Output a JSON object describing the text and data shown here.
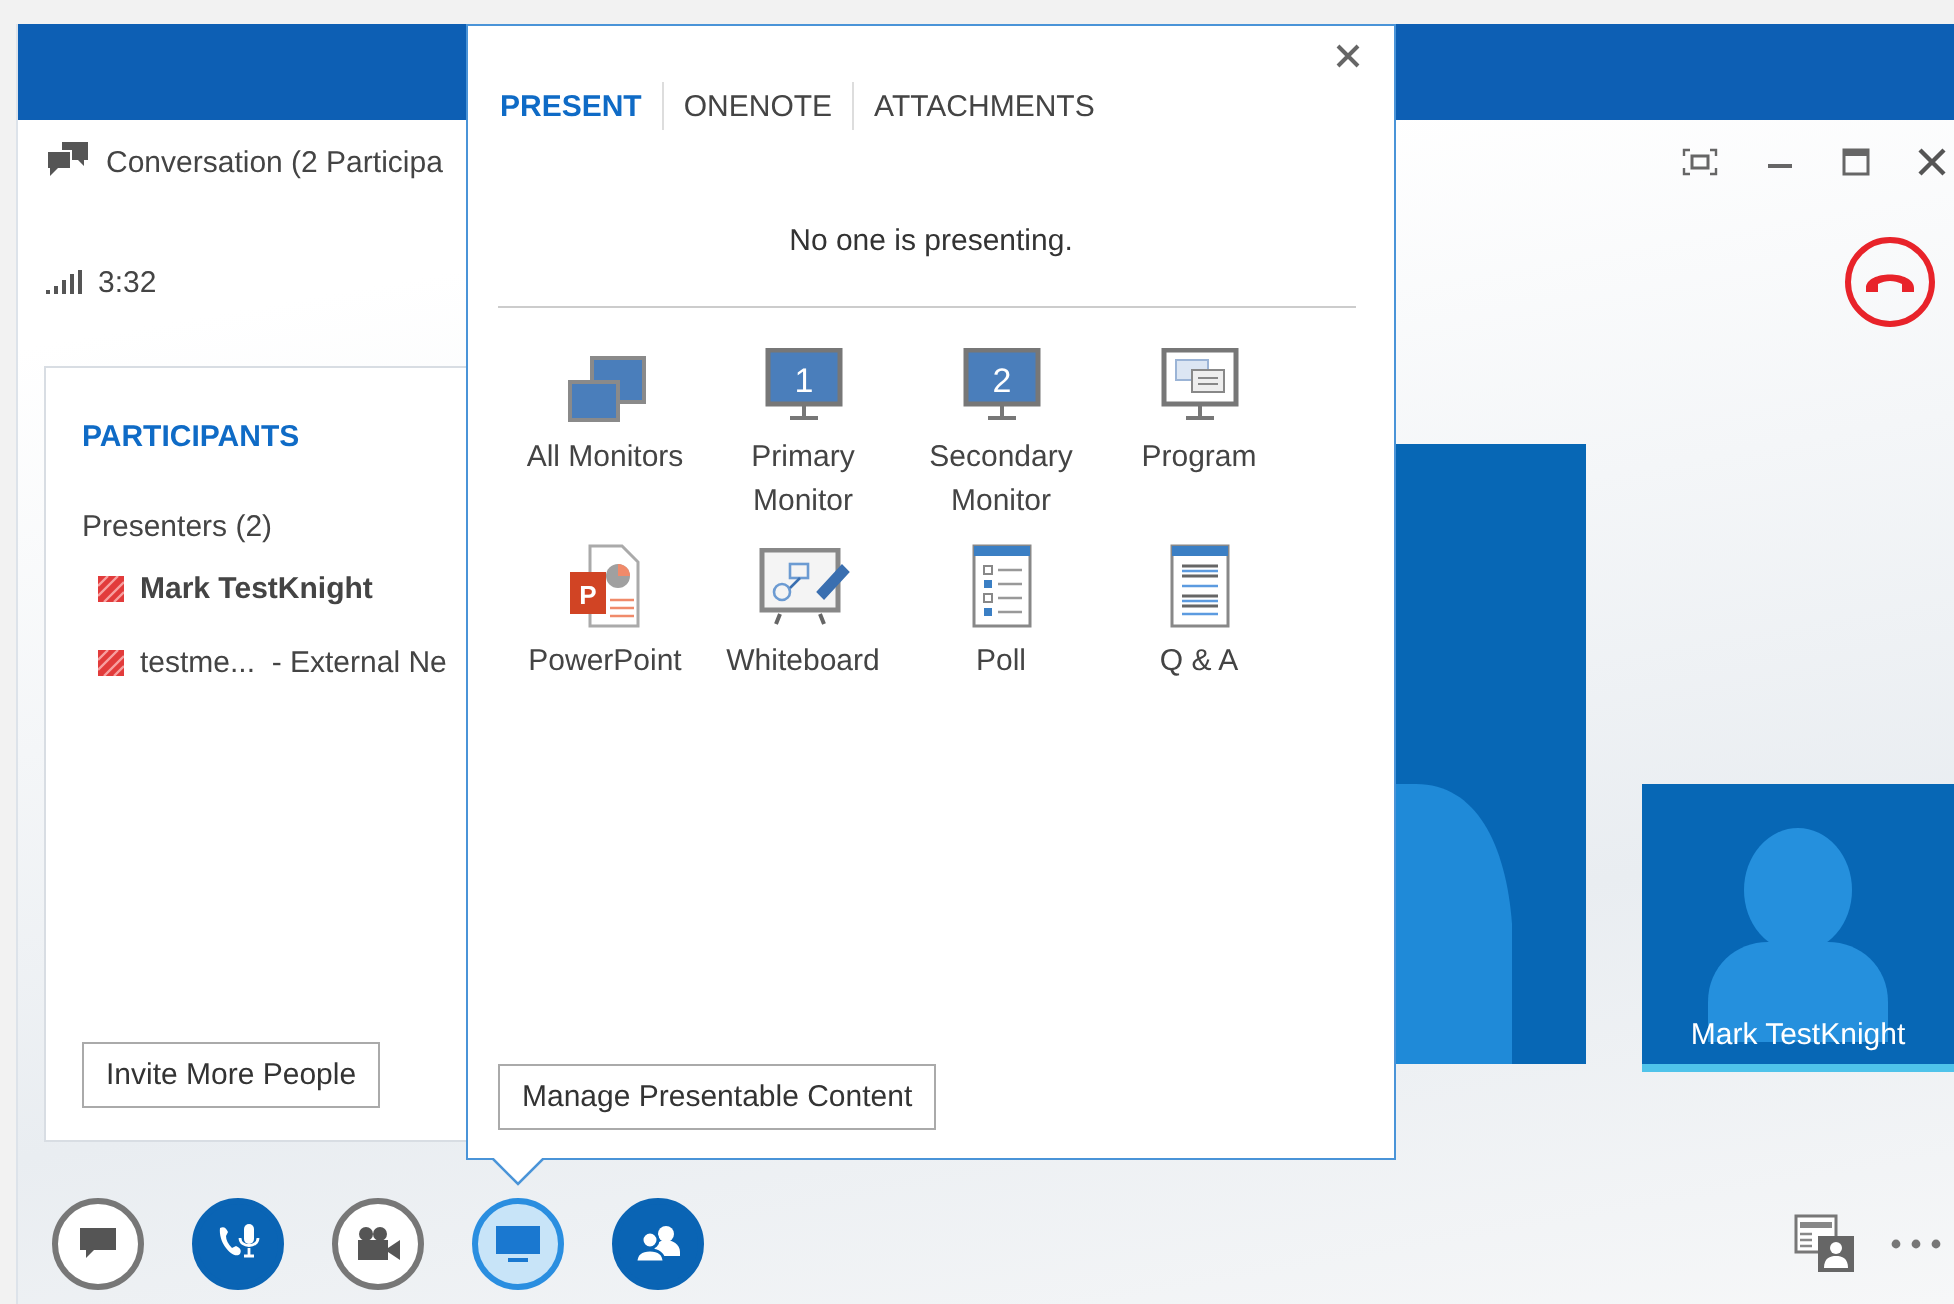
{
  "window": {
    "title": "Conversation (2 Participa",
    "call_time": "3:32"
  },
  "participants": {
    "heading": "PARTICIPANTS",
    "group": "Presenters (2)",
    "people": [
      {
        "name": "Mark TestKnight",
        "is_self": true
      },
      {
        "name": "testme...  - External Ne",
        "is_self": false
      }
    ],
    "invite_button": "Invite More People"
  },
  "video_tiles": [
    {
      "kind": "large"
    },
    {
      "kind": "small",
      "name": "Mark TestKnight"
    }
  ],
  "toolbar": [
    {
      "kind": "chat",
      "on": false,
      "selected": false
    },
    {
      "kind": "audio",
      "on": true,
      "selected": false
    },
    {
      "kind": "video",
      "on": false,
      "selected": false
    },
    {
      "kind": "present",
      "on": false,
      "selected": true
    },
    {
      "kind": "people",
      "on": true,
      "selected": false
    }
  ],
  "present_popup": {
    "tabs": [
      {
        "label": "PRESENT",
        "selected": true
      },
      {
        "label": "ONENOTE",
        "selected": false
      },
      {
        "label": "ATTACHMENTS",
        "selected": false
      }
    ],
    "status": "No one is presenting.",
    "options": [
      {
        "kind": "all-monitors",
        "label": "All Monitors"
      },
      {
        "kind": "primary",
        "glyph": "1",
        "label": "Primary Monitor"
      },
      {
        "kind": "secondary",
        "glyph": "2",
        "label": "Secondary Monitor"
      },
      {
        "kind": "program",
        "label": "Program"
      },
      {
        "kind": "powerpoint",
        "glyph": "P",
        "label": "PowerPoint"
      },
      {
        "kind": "whiteboard",
        "label": "Whiteboard"
      },
      {
        "kind": "poll",
        "label": "Poll"
      },
      {
        "kind": "qa",
        "label": "Q & A"
      }
    ],
    "manage_button": "Manage Presentable Content"
  }
}
